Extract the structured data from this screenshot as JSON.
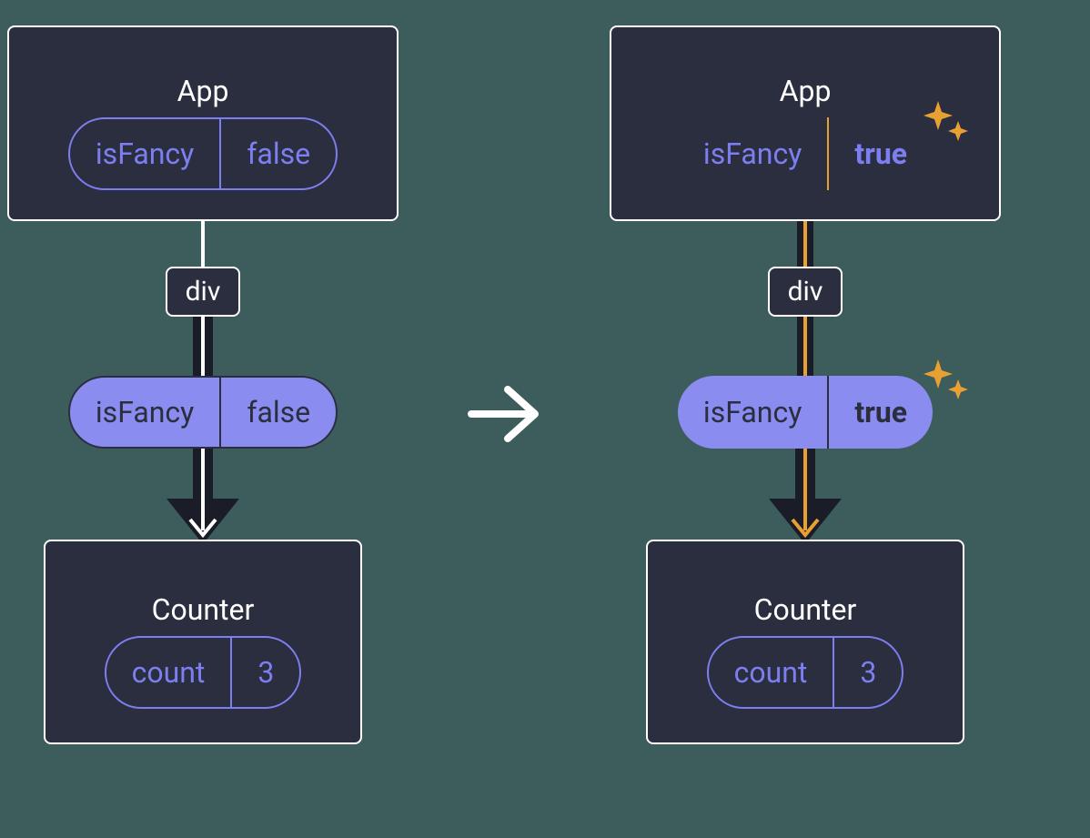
{
  "left": {
    "app": {
      "title": "App",
      "prop": {
        "name": "isFancy",
        "value": "false"
      }
    },
    "div": "div",
    "midProp": {
      "name": "isFancy",
      "value": "false"
    },
    "counter": {
      "title": "Counter",
      "state": {
        "name": "count",
        "value": "3"
      }
    }
  },
  "right": {
    "app": {
      "title": "App",
      "prop": {
        "name": "isFancy",
        "value": "true"
      }
    },
    "div": "div",
    "midProp": {
      "name": "isFancy",
      "value": "true"
    },
    "counter": {
      "title": "Counter",
      "state": {
        "name": "count",
        "value": "3"
      }
    }
  },
  "colors": {
    "bg": "#3d5c5c",
    "box": "#2a2e3f",
    "outline": "#ffffff",
    "accent": "#7d7ff0",
    "pillFill": "#8b8cf0",
    "highlight": "#e8a033"
  }
}
